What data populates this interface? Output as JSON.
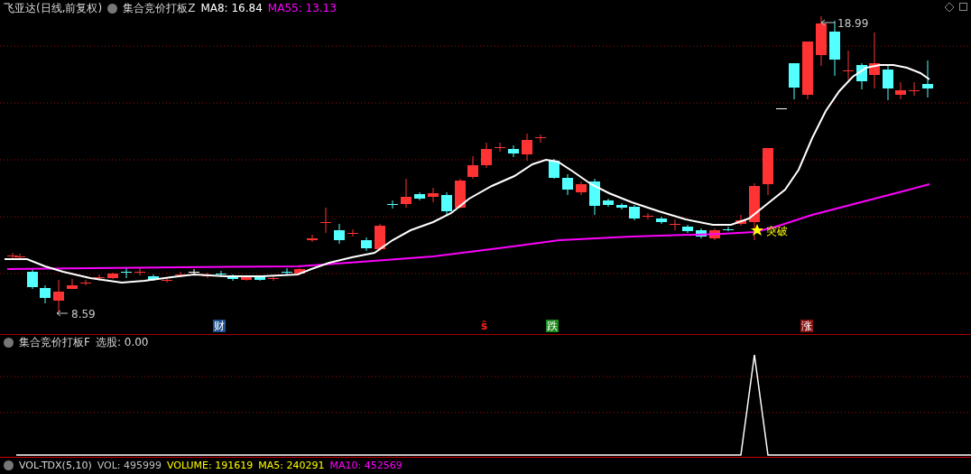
{
  "header": {
    "stock_title": "飞亚达(日线,前复权)",
    "indicator": "集合竞价打板Z",
    "readings": [
      {
        "text": "MA8: 16.84",
        "color": "#ffffff"
      },
      {
        "text": "MA55: 13.13",
        "color": "#ff00ff"
      }
    ]
  },
  "main_chart": {
    "high_label": "18.99",
    "low_label": "8.59",
    "signal_label": "突破",
    "markers": [
      {
        "text": "财",
        "kind": "box",
        "color": "#1f4f8f"
      },
      {
        "text": "ŝ",
        "kind": "plain",
        "color": "#ff2020"
      },
      {
        "text": "跌",
        "kind": "box",
        "color": "#1a8a1a"
      },
      {
        "text": "涨",
        "kind": "box",
        "color": "#8b1010"
      }
    ]
  },
  "lower_panel": {
    "indicator": "集合竞价打板F",
    "reading": "选股: 0.00"
  },
  "volume_bar": {
    "indicator": "VOL-TDX(5,10)",
    "readings": [
      {
        "text": "VOL: 495999",
        "color": "#c0c0c0"
      },
      {
        "text": "VOLUME: 191619",
        "color": "#ffff00"
      },
      {
        "text": "MA5: 240291",
        "color": "#ffff00"
      },
      {
        "text": "MA10: 452569",
        "color": "#ff00ff"
      }
    ]
  }
}
